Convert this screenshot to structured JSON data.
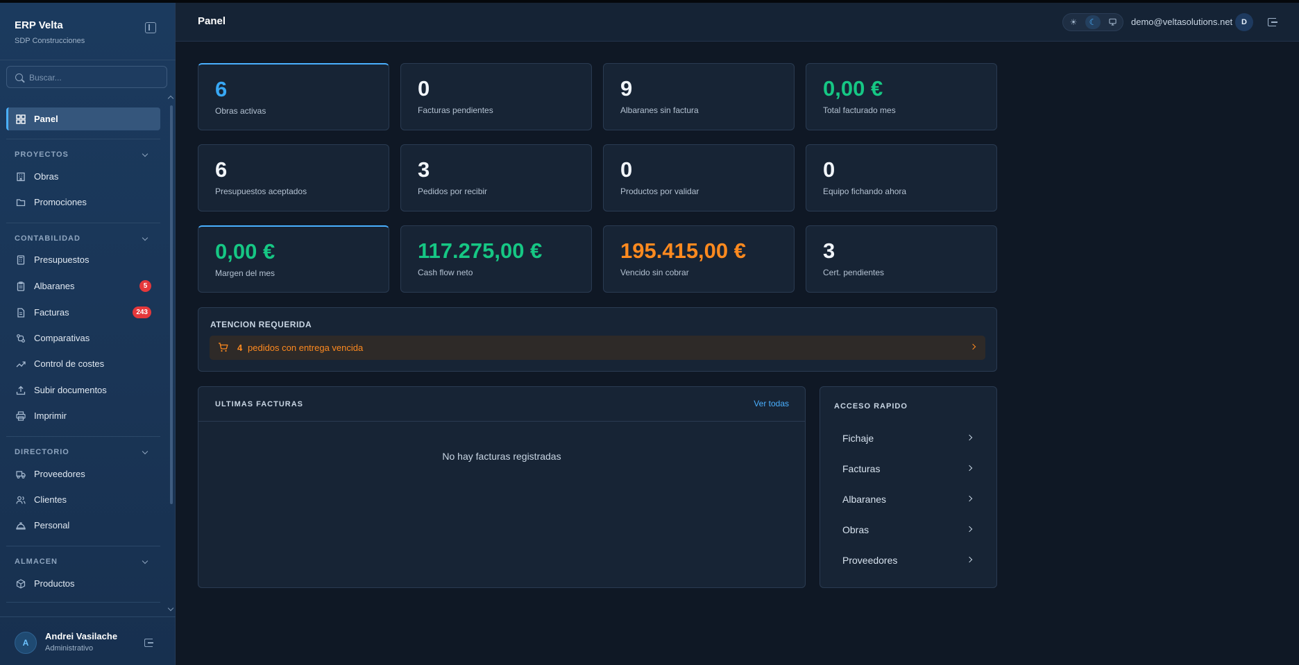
{
  "app": {
    "title": "ERP Velta",
    "company": "SDP Construcciones"
  },
  "search": {
    "placeholder": "Buscar..."
  },
  "nav": {
    "panel": "Panel",
    "sections": {
      "proyectos": "PROYECTOS",
      "contabilidad": "CONTABILIDAD",
      "directorio": "DIRECTORIO",
      "almacen": "ALMACEN"
    },
    "items": {
      "obras": "Obras",
      "promociones": "Promociones",
      "presupuestos": "Presupuestos",
      "albaranes": "Albaranes",
      "facturas": "Facturas",
      "comparativas": "Comparativas",
      "control_costes": "Control de costes",
      "subir_documentos": "Subir documentos",
      "imprimir": "Imprimir",
      "proveedores": "Proveedores",
      "clientes": "Clientes",
      "personal": "Personal",
      "productos": "Productos"
    },
    "badges": {
      "albaranes": "5",
      "facturas": "243"
    }
  },
  "user": {
    "initial": "A",
    "name": "Andrei Vasilache",
    "role": "Administrativo"
  },
  "header": {
    "title": "Panel",
    "email": "demo@veltasolutions.net",
    "avatar_initial": "D",
    "theme_icons": [
      "sun-icon",
      "moon-icon",
      "monitor-icon"
    ],
    "active_theme": "dark"
  },
  "kpis": [
    {
      "value": "6",
      "label": "Obras activas",
      "color": "#38a8f5"
    },
    {
      "value": "0",
      "label": "Facturas pendientes",
      "color": "#f1f5fa"
    },
    {
      "value": "9",
      "label": "Albaranes sin factura",
      "color": "#f1f5fa"
    },
    {
      "value": "0,00 €",
      "label": "Total facturado mes",
      "color": "#16c784"
    },
    {
      "value": "6",
      "label": "Presupuestos aceptados",
      "color": "#f1f5fa"
    },
    {
      "value": "3",
      "label": "Pedidos por recibir",
      "color": "#f1f5fa"
    },
    {
      "value": "0",
      "label": "Productos por validar",
      "color": "#f1f5fa"
    },
    {
      "value": "0",
      "label": "Equipo fichando ahora",
      "color": "#f1f5fa"
    },
    {
      "value": "0,00 €",
      "label": "Margen del mes",
      "color": "#16c784"
    },
    {
      "value": "117.275,00 €",
      "label": "Cash flow neto",
      "color": "#16c784"
    },
    {
      "value": "195.415,00 €",
      "label": "Vencido sin cobrar",
      "color": "#ff8a1f"
    },
    {
      "value": "3",
      "label": "Cert. pendientes",
      "color": "#f1f5fa"
    }
  ],
  "attention": {
    "title": "ATENCION REQUERIDA",
    "count": "4",
    "text": "pedidos con entrega vencida",
    "color": "#ff8a1f"
  },
  "invoices": {
    "title": "ULTIMAS FACTURAS",
    "link": "Ver todas",
    "empty": "No hay facturas registradas"
  },
  "quick_access": {
    "title": "ACCESO RAPIDO",
    "items": [
      "Fichaje",
      "Facturas",
      "Albaranes",
      "Obras",
      "Proveedores"
    ]
  },
  "colors": {
    "accent": "#4ab0ff",
    "positive": "#16c784",
    "warning": "#ff8a1f",
    "badge": "#e5383b"
  }
}
